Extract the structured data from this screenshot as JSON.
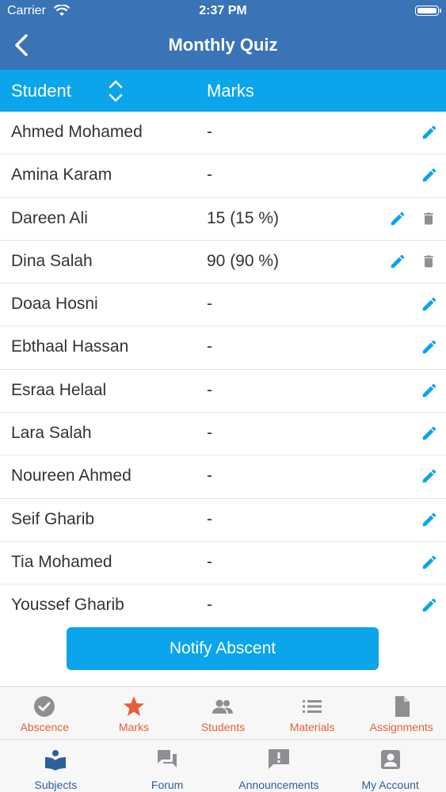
{
  "status_bar": {
    "carrier": "Carrier",
    "time": "2:37 PM"
  },
  "nav": {
    "title": "Monthly Quiz"
  },
  "table": {
    "headers": {
      "student": "Student",
      "marks": "Marks"
    },
    "rows": [
      {
        "name": "Ahmed Mohamed",
        "mark": "-",
        "deletable": false
      },
      {
        "name": "Amina Karam",
        "mark": "-",
        "deletable": false
      },
      {
        "name": "Dareen Ali",
        "mark": "15 (15 %)",
        "deletable": true
      },
      {
        "name": "Dina Salah",
        "mark": "90 (90 %)",
        "deletable": true
      },
      {
        "name": "Doaa Hosni",
        "mark": "-",
        "deletable": false
      },
      {
        "name": "Ebthaal Hassan",
        "mark": "-",
        "deletable": false
      },
      {
        "name": "Esraa Helaal",
        "mark": "-",
        "deletable": false
      },
      {
        "name": "Lara Salah",
        "mark": "-",
        "deletable": false
      },
      {
        "name": "Noureen Ahmed",
        "mark": "-",
        "deletable": false
      },
      {
        "name": "Seif Gharib",
        "mark": "-",
        "deletable": false
      },
      {
        "name": "Tia Mohamed",
        "mark": "-",
        "deletable": false
      },
      {
        "name": "Youssef Gharib",
        "mark": "-",
        "deletable": false
      }
    ]
  },
  "notify_button": "Notify Abscent",
  "sub_tabs": [
    {
      "label": "Abscence",
      "icon": "check-circle-icon",
      "active": false
    },
    {
      "label": "Marks",
      "icon": "star-icon",
      "active": true
    },
    {
      "label": "Students",
      "icon": "people-icon",
      "active": false
    },
    {
      "label": "Materials",
      "icon": "list-icon",
      "active": false
    },
    {
      "label": "Assignments",
      "icon": "document-icon",
      "active": false
    }
  ],
  "main_tabs": [
    {
      "label": "Subjects",
      "icon": "book-icon",
      "active": true
    },
    {
      "label": "Forum",
      "icon": "chat-icon",
      "active": false
    },
    {
      "label": "Announcements",
      "icon": "alert-icon",
      "active": false
    },
    {
      "label": "My Account",
      "icon": "account-icon",
      "active": false
    }
  ],
  "colors": {
    "nav_bg": "#3a73b6",
    "header_bg": "#0aa5ea",
    "accent": "#0aa5ea",
    "tab_label": "#e85d3a",
    "main_tab_label": "#2d5f9a",
    "icon_gray": "#8e8e93"
  }
}
